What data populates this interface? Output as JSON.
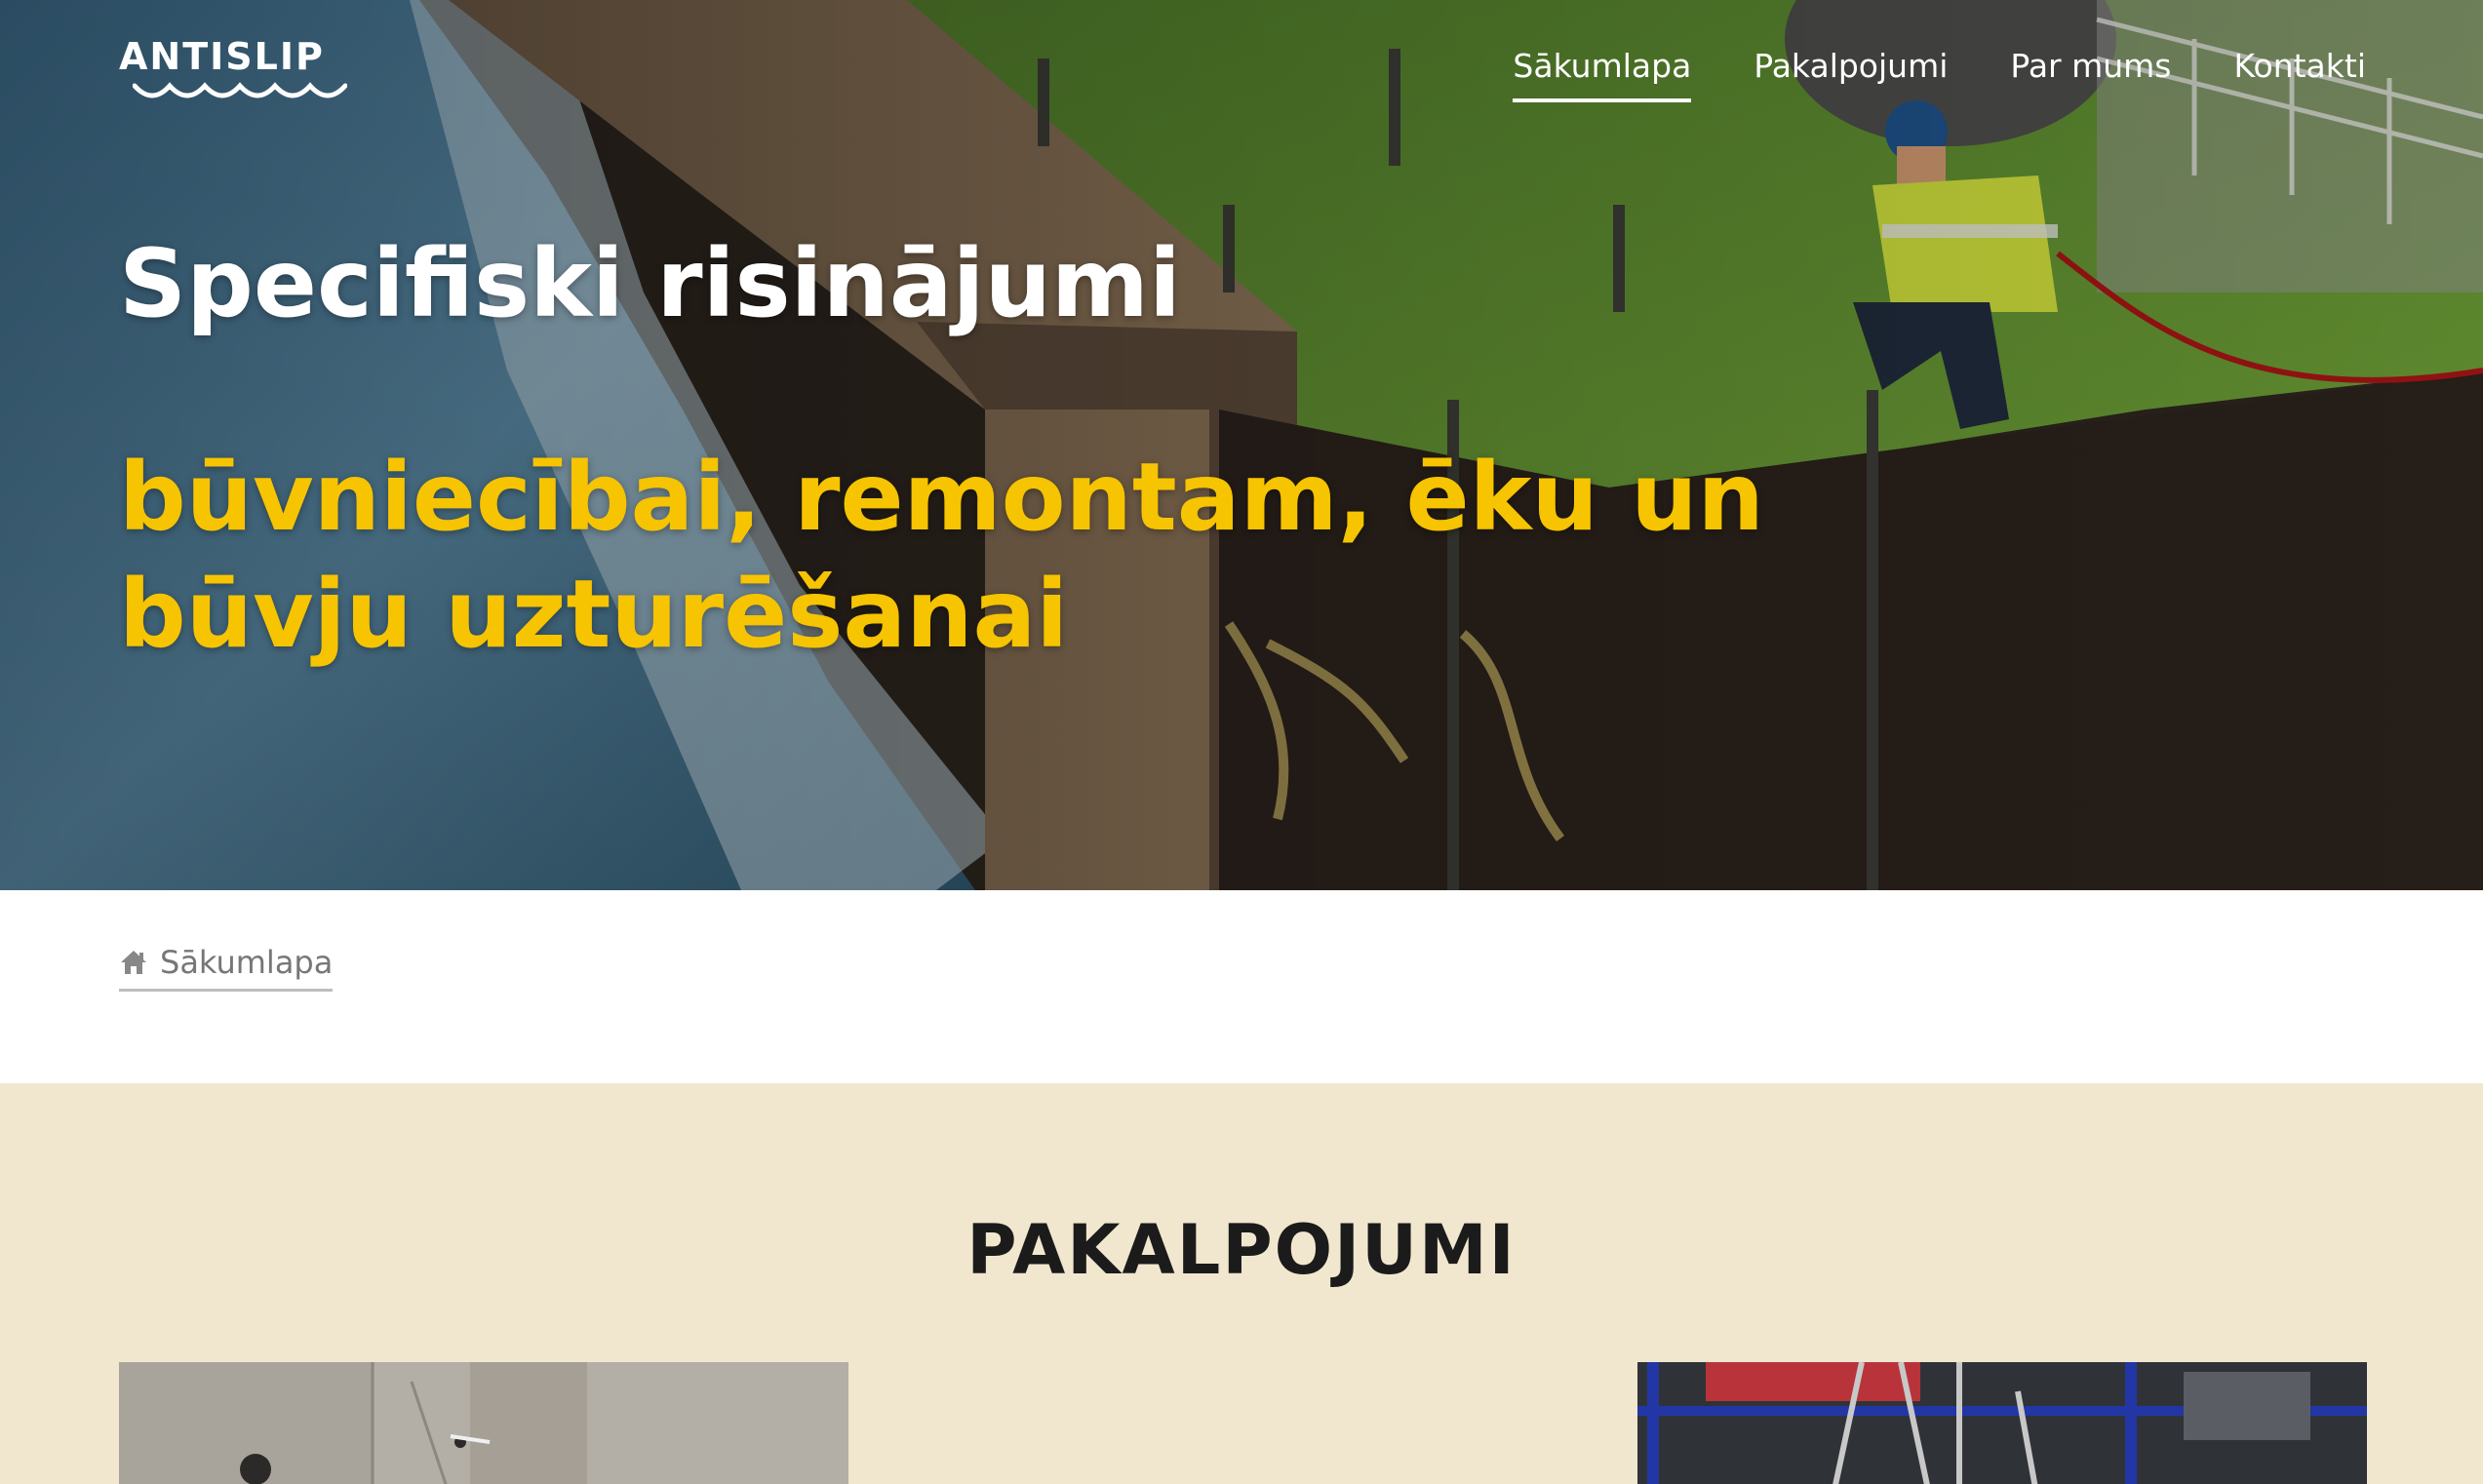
{
  "header": {
    "logo_text": "ANTISLIP",
    "nav": [
      {
        "label": "Sākumlapa",
        "active": true
      },
      {
        "label": "Pakalpojumi",
        "active": false
      },
      {
        "label": "Par mums",
        "active": false
      },
      {
        "label": "Kontakti",
        "active": false
      }
    ]
  },
  "hero": {
    "title": "Specifiski risinājumi",
    "subtitle": "būvniecībai, remontam, ēku un būvju uzturēšanai",
    "subtitle_color": "#f6c400"
  },
  "breadcrumb": {
    "icon": "home-icon",
    "label": "Sākumlapa"
  },
  "services": {
    "title": "PAKALPOJUMI",
    "background": "#f1e7cf"
  }
}
